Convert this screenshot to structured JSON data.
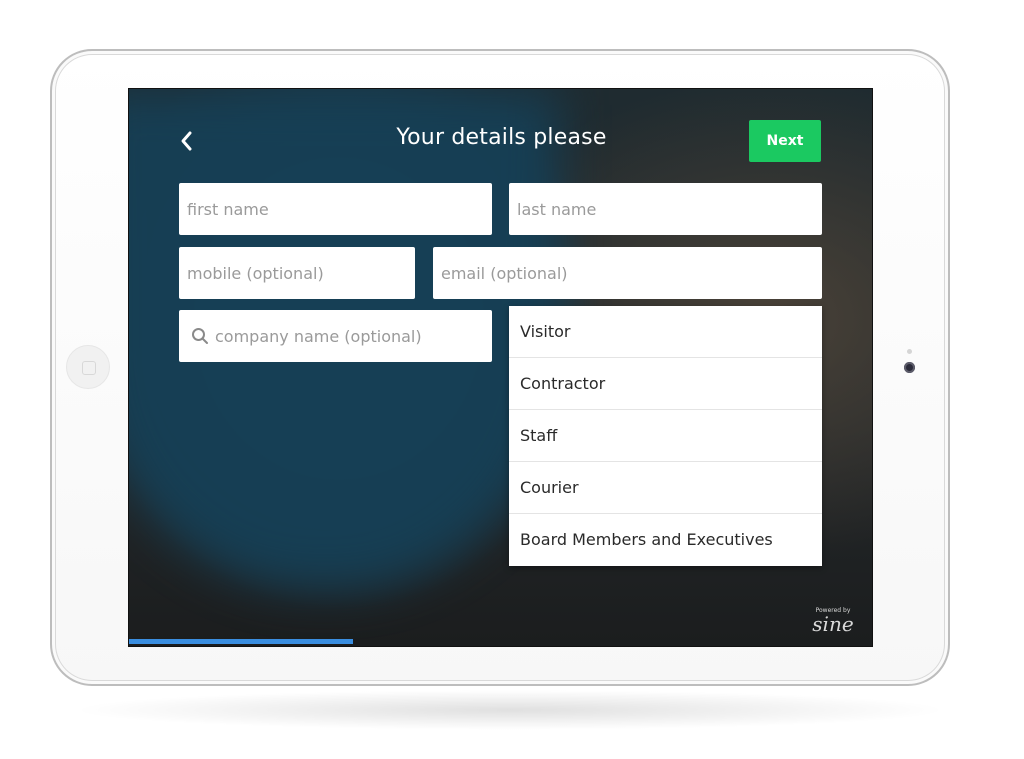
{
  "header": {
    "title": "Your details please",
    "next_label": "Next"
  },
  "form": {
    "first_name_placeholder": "first name",
    "last_name_placeholder": "last name",
    "mobile_placeholder": "mobile (optional)",
    "email_placeholder": "email (optional)",
    "company_placeholder": "company name (optional)"
  },
  "visitor_type_options": [
    "Visitor",
    "Contractor",
    "Staff",
    "Courier",
    "Board Members and Executives"
  ],
  "footer": {
    "powered_by": "Powered by",
    "brand": "sine"
  },
  "progress": {
    "fraction": 0.3
  },
  "colors": {
    "accent_next": "#1bc961",
    "progress": "#3a8ee0"
  },
  "icons": {
    "back": "chevron-left-icon",
    "search": "search-icon"
  }
}
